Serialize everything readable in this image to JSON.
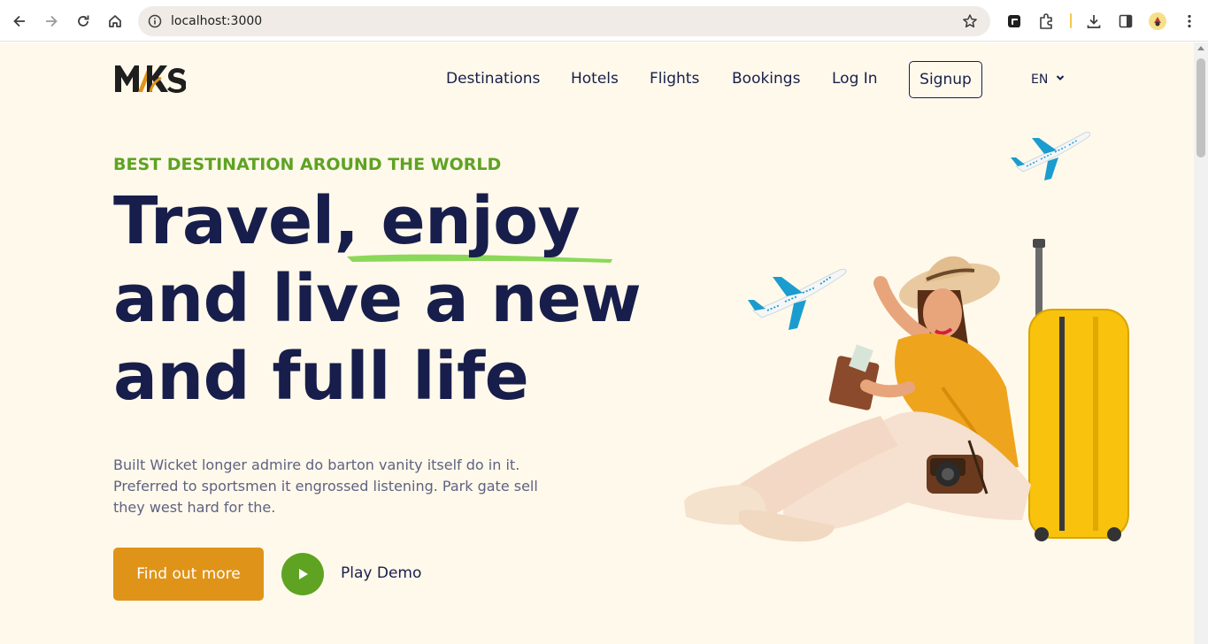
{
  "browser": {
    "url": "localhost:3000"
  },
  "nav": {
    "logo": "MKS",
    "items": [
      "Destinations",
      "Hotels",
      "Flights",
      "Bookings",
      "Log In"
    ],
    "signup": "Signup",
    "language": "EN"
  },
  "hero": {
    "tagline": "BEST DESTINATION AROUND THE WORLD",
    "headline_part1": "Travel, ",
    "headline_highlight": "enjoy",
    "headline_line2": "and live a new",
    "headline_line3": "and full life",
    "description_line1": "Built Wicket longer admire do barton vanity itself do in it.",
    "description_line2": "Preferred to sportsmen it engrossed listening. Park gate sell",
    "description_line3": "they west hard for the.",
    "cta_label": "Find out more",
    "play_label": "Play Demo"
  },
  "colors": {
    "page_bg": "#fff9eb",
    "navy": "#181e4b",
    "green": "#5fa322",
    "orange": "#df9419",
    "muted": "#5e6282"
  }
}
